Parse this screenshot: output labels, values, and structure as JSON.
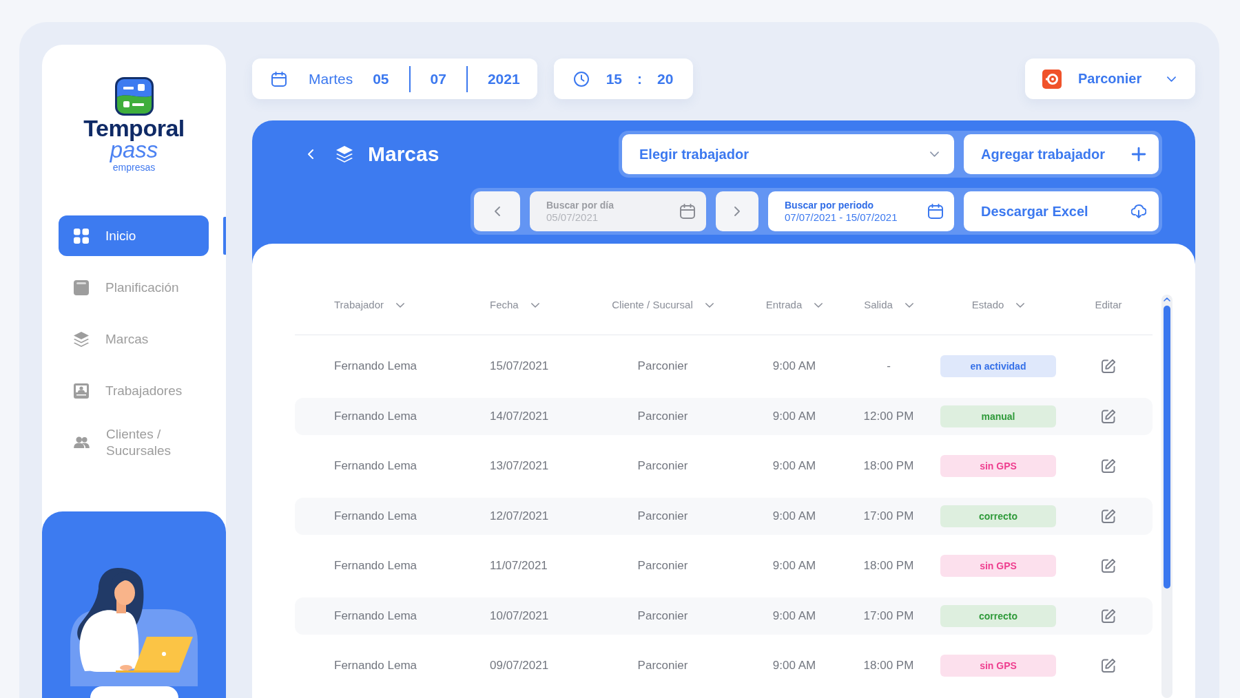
{
  "logo": {
    "name": "Temporal",
    "product": "pass",
    "tagline": "empresas"
  },
  "sidebar": {
    "items": [
      {
        "label": "Inicio",
        "selected": true
      },
      {
        "label": "Planificación",
        "selected": false
      },
      {
        "label": "Marcas",
        "selected": false
      },
      {
        "label": "Trabajadores",
        "selected": false
      },
      {
        "label": "Clientes / Sucursales",
        "selected": false
      }
    ]
  },
  "date": {
    "weekday": "Martes",
    "day": "05",
    "month": "07",
    "year": "2021"
  },
  "time": {
    "hour": "15",
    "separator": ":",
    "minute": "20"
  },
  "account": {
    "name": "Parconier"
  },
  "page": {
    "title": "Marcas"
  },
  "worker_select": {
    "label": "Elegir trabajador"
  },
  "add_button": {
    "label": "Agregar trabajador"
  },
  "date_filters": [
    {
      "label": "Buscar por día",
      "value": "05/07/2021",
      "selected": false
    },
    {
      "label": "Buscar por periodo",
      "value": "07/07/2021 - 15/07/2021",
      "selected": true
    }
  ],
  "export_button": {
    "label": "Descargar Excel"
  },
  "table": {
    "columns": [
      {
        "label": "Trabajador",
        "sortable": true
      },
      {
        "label": "Fecha",
        "sortable": true
      },
      {
        "label": "Cliente / Sucursal",
        "sortable": true
      },
      {
        "label": "Entrada",
        "sortable": true
      },
      {
        "label": "Salida",
        "sortable": true
      },
      {
        "label": "Estado",
        "sortable": true
      },
      {
        "label": "Editar",
        "sortable": false
      }
    ],
    "rows": [
      {
        "worker": "Fernando Lema",
        "date": "15/07/2021",
        "client": "Parconier",
        "entry": "9:00 AM",
        "exit": "-",
        "status": {
          "label": "en actividad",
          "color": "#3570e8"
        }
      },
      {
        "worker": "Fernando Lema",
        "date": "14/07/2021",
        "client": "Parconier",
        "entry": "9:00 AM",
        "exit": "12:00 PM",
        "status": {
          "label": "manual",
          "color": "#2f9a3a"
        }
      },
      {
        "worker": "Fernando Lema",
        "date": "13/07/2021",
        "client": "Parconier",
        "entry": "9:00 AM",
        "exit": "18:00 PM",
        "status": {
          "label": "sin GPS",
          "color": "#ee3e8f"
        }
      },
      {
        "worker": "Fernando Lema",
        "date": "12/07/2021",
        "client": "Parconier",
        "entry": "9:00 AM",
        "exit": "17:00 PM",
        "status": {
          "label": "correcto",
          "color": "#2f9a3a"
        }
      },
      {
        "worker": "Fernando Lema",
        "date": "11/07/2021",
        "client": "Parconier",
        "entry": "9:00 AM",
        "exit": "18:00 PM",
        "status": {
          "label": "sin GPS",
          "color": "#ee3e8f"
        }
      },
      {
        "worker": "Fernando Lema",
        "date": "10/07/2021",
        "client": "Parconier",
        "entry": "9:00 AM",
        "exit": "17:00 PM",
        "status": {
          "label": "correcto",
          "color": "#2f9a3a"
        }
      },
      {
        "worker": "Fernando Lema",
        "date": "09/07/2021",
        "client": "Parconier",
        "entry": "9:00 AM",
        "exit": "18:00 PM",
        "status": {
          "label": "sin GPS",
          "color": "#ee3e8f"
        }
      }
    ]
  }
}
